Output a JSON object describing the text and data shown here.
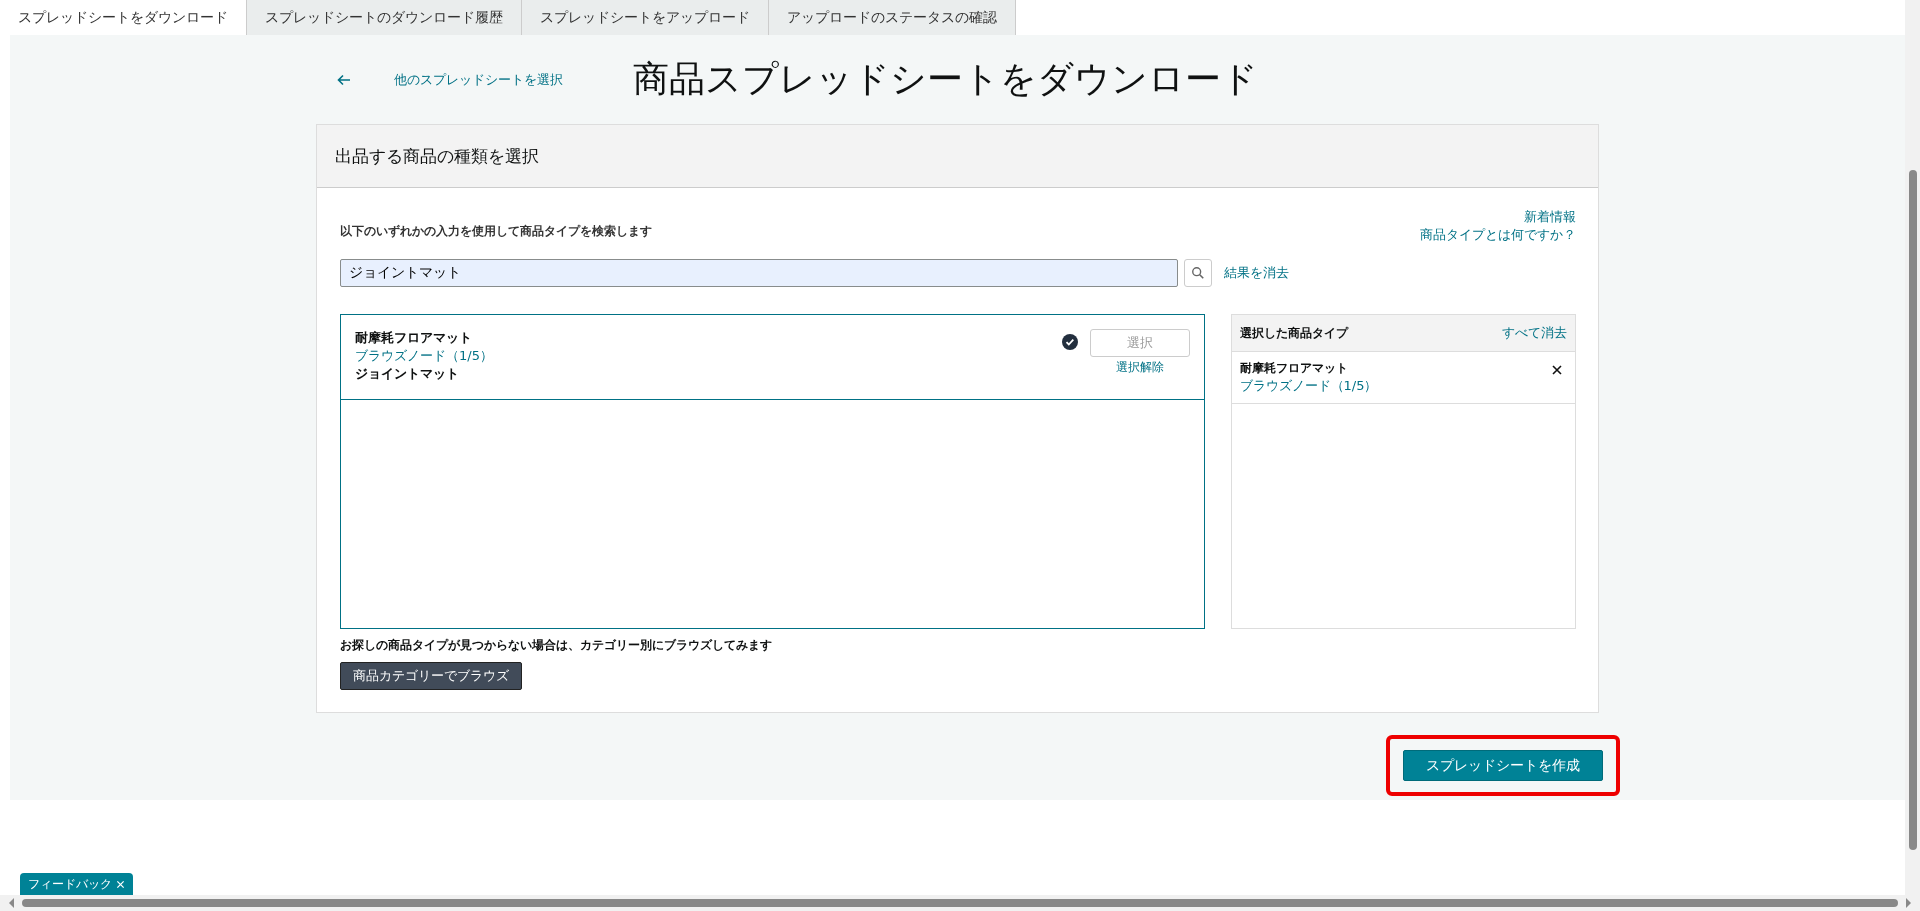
{
  "tabs": [
    {
      "label": "スプレッドシートをダウンロード",
      "selected": true
    },
    {
      "label": "スプレッドシートのダウンロード履歴",
      "selected": false
    },
    {
      "label": "スプレッドシートをアップロード",
      "selected": false
    },
    {
      "label": "アップロードのステータスの確認",
      "selected": false
    }
  ],
  "back_link": "他のスプレッドシートを選択",
  "page_title": "商品スプレッドシートをダウンロード",
  "card": {
    "title": "出品する商品の種類を選択",
    "search_hint": "以下のいずれかの入力を使用して商品タイプを検索します",
    "help_links": [
      "新着情報",
      "商品タイプとは何ですか？"
    ],
    "search": {
      "value": "ジョイントマット"
    },
    "clear_results": "結果を消去",
    "results": [
      {
        "name": "耐摩耗フロアマット",
        "browse_node": "ブラウズノード（1/5）",
        "keyword": "ジョイントマット",
        "selected": true,
        "select_button": "選択",
        "deselect_link": "選択解除"
      }
    ],
    "selected_panel": {
      "title": "選択した商品タイプ",
      "clear_all": "すべて消去",
      "items": [
        {
          "name": "耐摩耗フロアマット",
          "browse_node": "ブラウズノード（1/5）"
        }
      ]
    },
    "not_found_text": "お探しの商品タイプが見つからない場合は、カテゴリー別にブラウズしてみます",
    "browse_button": "商品カテゴリーでブラウズ"
  },
  "create_button": "スプレッドシートを作成",
  "feedback_tab": "フィードバック"
}
